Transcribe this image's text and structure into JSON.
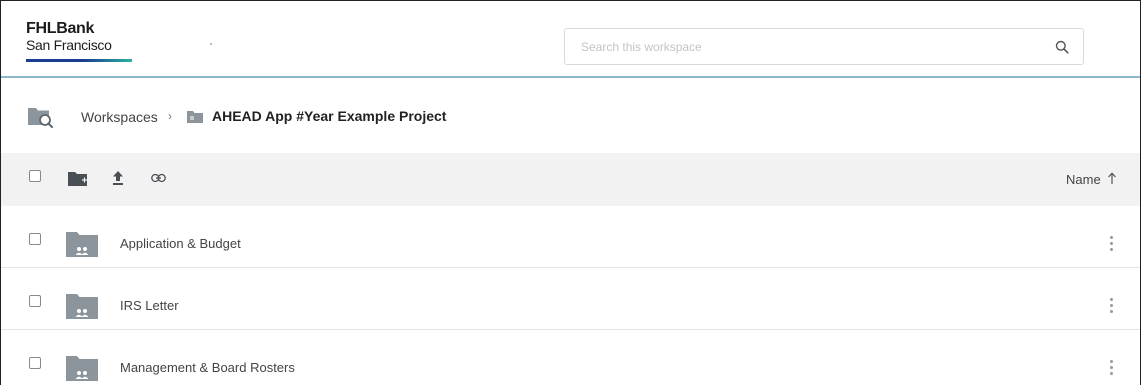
{
  "brand": {
    "line1": "FHLBank",
    "line2": "San Francisco",
    "bar_color_primary": "#1a3d8f",
    "bar_color_secondary": "#2bb3a4"
  },
  "search": {
    "placeholder": "Search this workspace",
    "icon": "search-icon"
  },
  "breadcrumb": {
    "root_label": "Workspaces",
    "separator": "›",
    "current_label": "AHEAD App #Year Example Project",
    "root_icon": "folder-search-icon",
    "current_icon": "workspace-folder-icon"
  },
  "toolbar": {
    "icons": [
      "new-folder-icon",
      "upload-icon",
      "link-icon"
    ],
    "sort_label": "Name",
    "sort_direction": "ascending"
  },
  "items": [
    {
      "label": "Application & Budget",
      "icon": "shared-folder-icon"
    },
    {
      "label": "IRS Letter",
      "icon": "shared-folder-icon"
    },
    {
      "label": "Management & Board Rosters",
      "icon": "shared-folder-icon"
    }
  ],
  "colors": {
    "header_border": "#8fb8cc",
    "toolbar_bg": "#f2f2f2",
    "folder_icon": "#8c949c"
  }
}
